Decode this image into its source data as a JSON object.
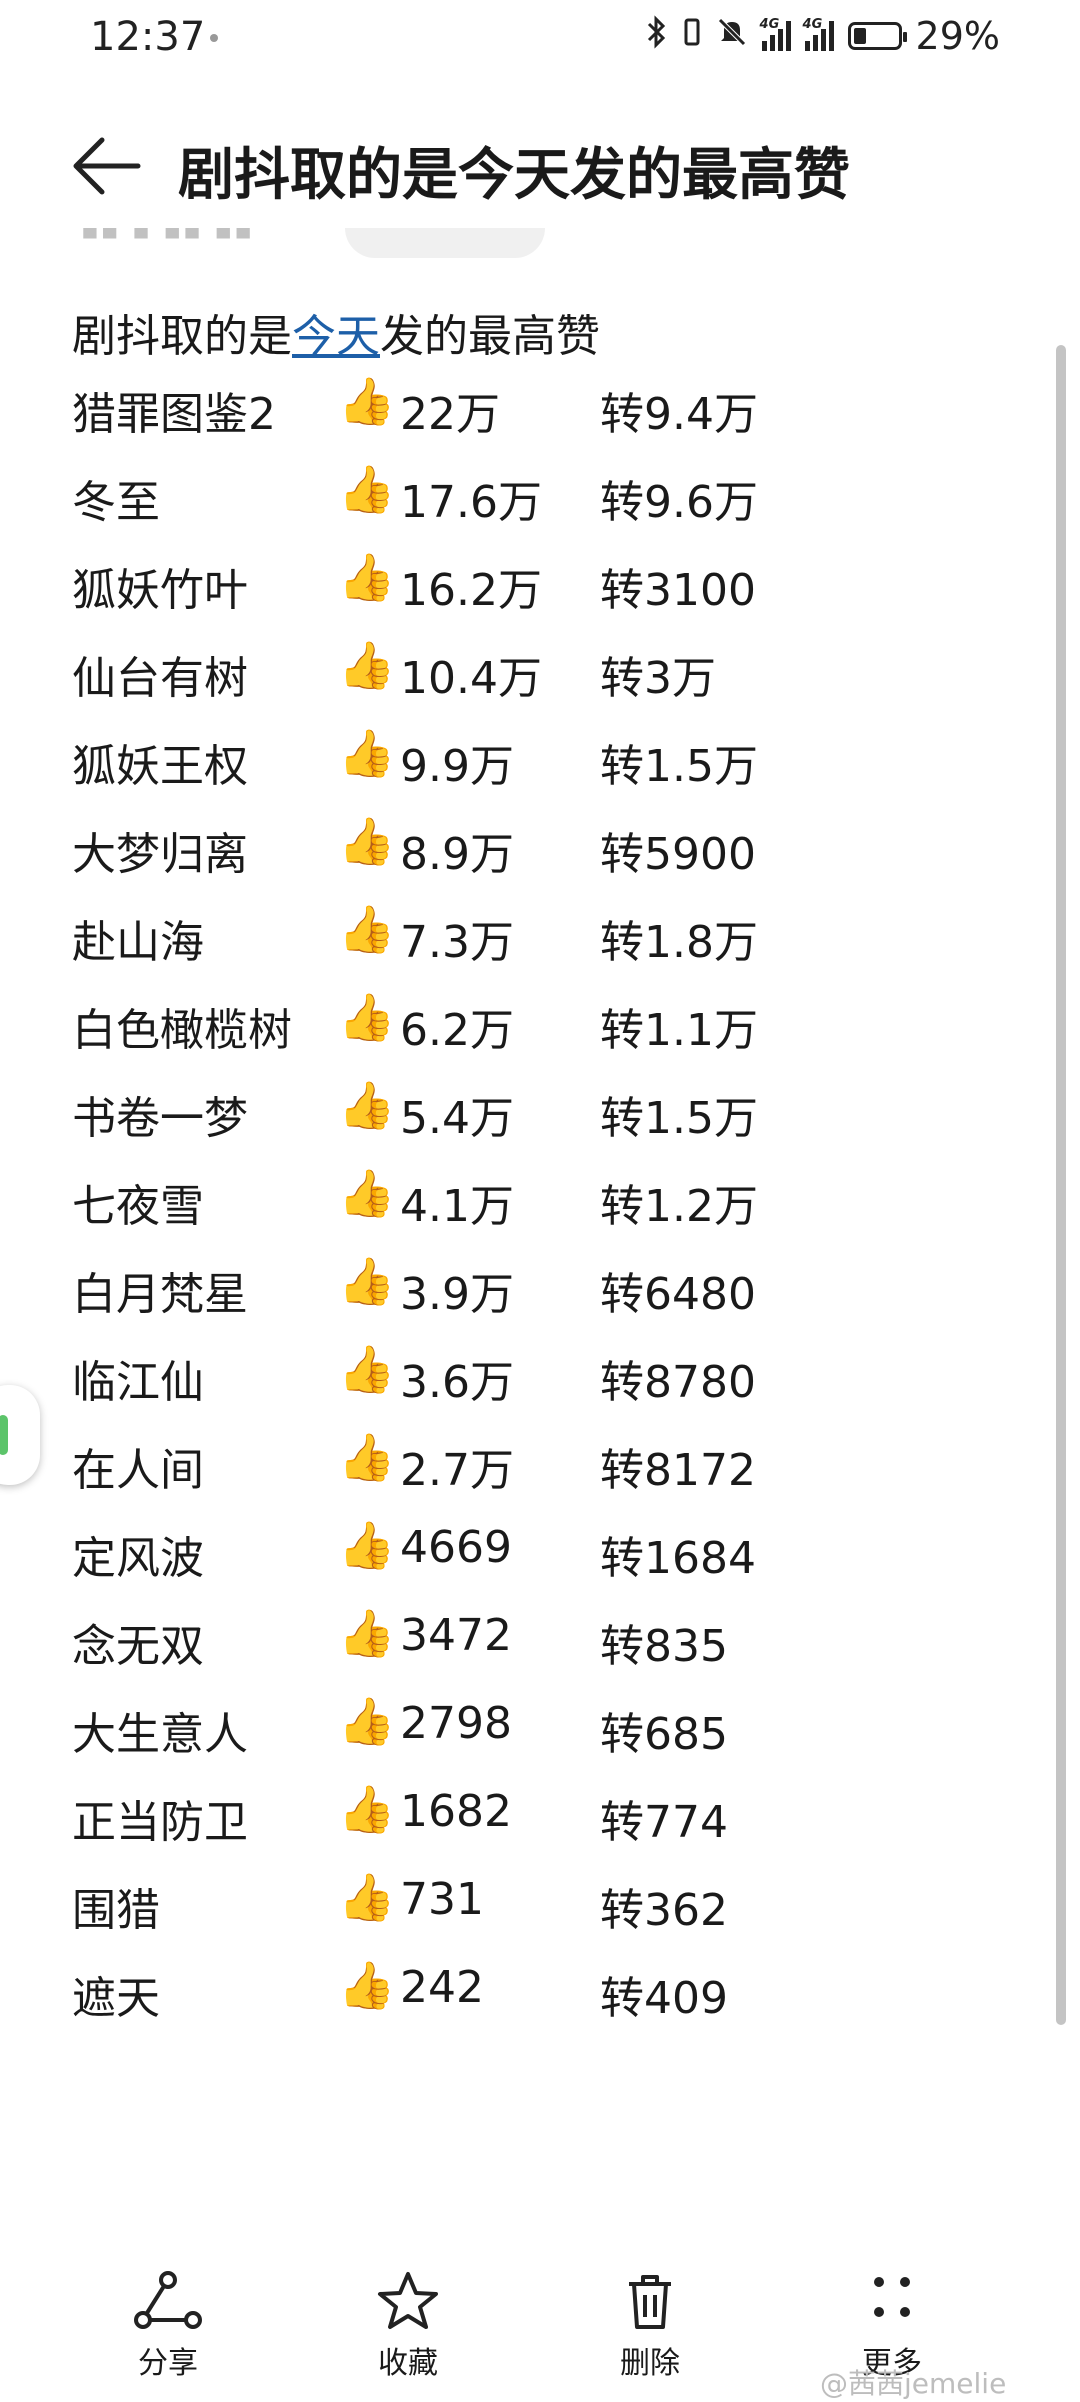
{
  "status": {
    "time": "12:37",
    "battery": "29%",
    "battery_level": 0.29,
    "net1": "4G",
    "net2": "4G"
  },
  "header": {
    "title": "剧抖取的是今天发的最高赞"
  },
  "note": {
    "heading_pre": "剧抖取的是",
    "heading_link": "今天",
    "heading_post": "发的最高赞",
    "thumb_icon": "thumbs-up-icon",
    "rows": [
      {
        "name": "猎罪图鉴2",
        "likes": "22万",
        "reposts": "转9.4万"
      },
      {
        "name": "冬至",
        "likes": "17.6万",
        "reposts": "转9.6万"
      },
      {
        "name": "狐妖竹叶",
        "likes": "16.2万",
        "reposts": "转3100"
      },
      {
        "name": "仙台有树",
        "likes": "10.4万",
        "reposts": "转3万"
      },
      {
        "name": "狐妖王权",
        "likes": "9.9万",
        "reposts": "转1.5万"
      },
      {
        "name": "大梦归离",
        "likes": "8.9万",
        "reposts": "转5900"
      },
      {
        "name": "赴山海",
        "likes": "7.3万",
        "reposts": "转1.8万"
      },
      {
        "name": "白色橄榄树",
        "likes": "6.2万",
        "reposts": "转1.1万"
      },
      {
        "name": "书卷一梦",
        "likes": "5.4万",
        "reposts": "转1.5万"
      },
      {
        "name": "七夜雪",
        "likes": "4.1万",
        "reposts": "转1.2万"
      },
      {
        "name": "白月梵星",
        "likes": "3.9万",
        "reposts": "转6480"
      },
      {
        "name": "临江仙",
        "likes": "3.6万",
        "reposts": "转8780"
      },
      {
        "name": "在人间",
        "likes": "2.7万",
        "reposts": "转8172"
      },
      {
        "name": "定风波",
        "likes": "4669",
        "reposts": "转1684"
      },
      {
        "name": "念无双",
        "likes": "3472",
        "reposts": "转835"
      },
      {
        "name": "大生意人",
        "likes": "2798",
        "reposts": "转685"
      },
      {
        "name": "正当防卫",
        "likes": "1682",
        "reposts": "转774"
      },
      {
        "name": "围猎",
        "likes": "731",
        "reposts": "转362"
      },
      {
        "name": "遮天",
        "likes": "242",
        "reposts": "转409"
      }
    ]
  },
  "bottom_bar": {
    "share": {
      "label": "分享",
      "icon": "share-icon"
    },
    "favorite": {
      "label": "收藏",
      "icon": "star-icon"
    },
    "delete": {
      "label": "删除",
      "icon": "trash-icon"
    },
    "more": {
      "label": "更多",
      "icon": "more-icon"
    }
  },
  "watermark": "@茜茜jemelie"
}
